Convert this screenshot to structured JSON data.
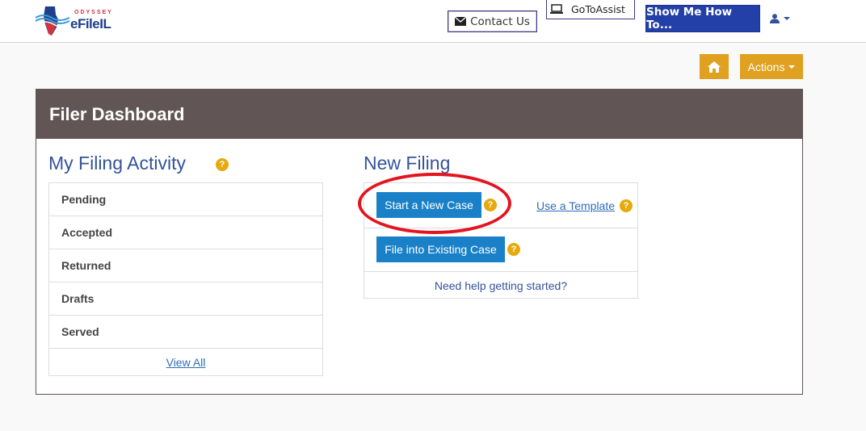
{
  "header": {
    "logo": {
      "brand_small": "ODYSSEY",
      "brand_main": "eFileIL"
    },
    "contact_label": "Contact Us",
    "gotoassist_label": "GoToAssist",
    "showme_label": "Show Me How To...",
    "user_menu_icon": "user-icon"
  },
  "toolbar": {
    "home_icon": "home-icon",
    "actions_label": "Actions"
  },
  "dashboard": {
    "title": "Filer Dashboard",
    "activity": {
      "title": "My Filing Activity",
      "items": [
        "Pending",
        "Accepted",
        "Returned",
        "Drafts",
        "Served"
      ],
      "view_all": "View All"
    },
    "new_filing": {
      "title": "New Filing",
      "start_new_case": "Start a New Case",
      "use_template": "Use a Template",
      "file_existing": "File into Existing Case",
      "help_link": "Need help getting started?"
    },
    "help_glyph": "?"
  },
  "colors": {
    "header_bg": "#615555",
    "accent_orange": "#e0a020",
    "primary_blue": "#1a81c8",
    "showme_blue": "#2240a8",
    "annotation_red": "#e3141f"
  }
}
